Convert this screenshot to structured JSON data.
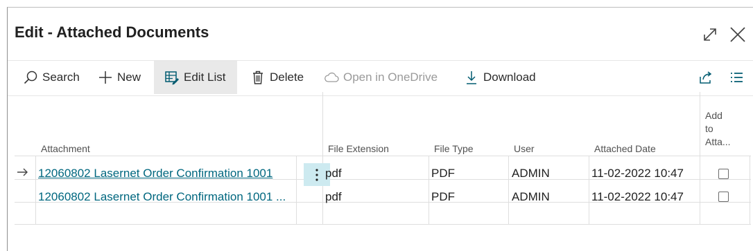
{
  "dialog": {
    "title": "Edit - Attached Documents",
    "expand_icon": "expand-icon",
    "close_icon": "close-icon"
  },
  "actions": {
    "search": {
      "label": "Search",
      "icon": "search-icon"
    },
    "new": {
      "label": "New",
      "icon": "plus-icon"
    },
    "edit_list": {
      "label": "Edit List",
      "icon": "edit-list-icon",
      "active": true
    },
    "delete": {
      "label": "Delete",
      "icon": "trash-icon"
    },
    "open_onedrive": {
      "label": "Open in OneDrive",
      "icon": "cloud-icon",
      "disabled": true
    },
    "download": {
      "label": "Download",
      "icon": "download-icon"
    },
    "share_icon": "share-icon",
    "list_icon": "list-view-icon"
  },
  "table": {
    "columns": {
      "attachment": "Attachment",
      "file_extension": "File Extension",
      "file_type": "File Type",
      "user": "User",
      "attached_date": "Attached Date",
      "add_to_1": "Add",
      "add_to_2": "to",
      "add_to_3": "Atta..."
    },
    "rows": [
      {
        "attachment": "12060802 Lasernet Order Confirmation 1001",
        "file_extension": "pdf",
        "file_type": "PDF",
        "user": "ADMIN",
        "attached_date": "11-02-2022 10:47",
        "add_to": false,
        "selected": true
      },
      {
        "attachment": "12060802 Lasernet Order Confirmation 1001 ...",
        "file_extension": "pdf",
        "file_type": "PDF",
        "user": "ADMIN",
        "attached_date": "11-02-2022 10:47",
        "add_to": false,
        "selected": false
      }
    ]
  },
  "colors": {
    "link": "#00677f",
    "active_action_bg": "#e9e9e9",
    "more_button_bg": "#cdeaf0",
    "grid_line": "#dedede"
  }
}
